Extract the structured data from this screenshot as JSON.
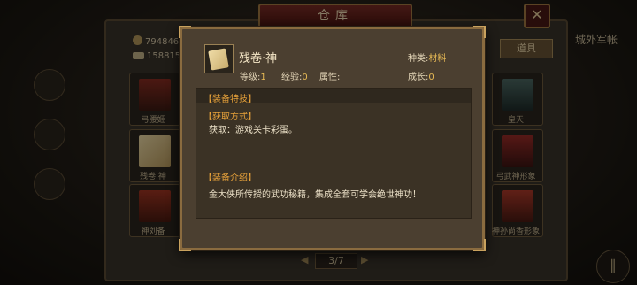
{
  "window": {
    "title": "仓库",
    "close_icon": "close-icon"
  },
  "resources": {
    "gold": "794846",
    "silver": "158815"
  },
  "side": {
    "tab_label": "道具",
    "right_label": "城外军帐"
  },
  "slots": [
    {
      "label": "弓腰姬",
      "icon": "character-portrait"
    },
    {
      "label": "残卷·神",
      "icon": "scroll-icon"
    },
    {
      "label": "神刘备",
      "icon": "character-portrait"
    },
    {
      "label": "皇天",
      "icon": "character-portrait"
    },
    {
      "label": "弓武神形象",
      "icon": "character-portrait"
    },
    {
      "label": "神孙尚香形象",
      "icon": "character-portrait"
    }
  ],
  "pager": {
    "text": "3/7"
  },
  "modal": {
    "item_name": "残卷·神",
    "type_label": "种类:",
    "type_value": "材料",
    "level_label": "等级:",
    "level_value": "1",
    "exp_label": "经验:",
    "exp_value": "0",
    "attr_label": "属性:",
    "growth_label": "成长:",
    "growth_value": "0",
    "section_special": "【装备特技】",
    "section_source": "【获取方式】",
    "source_text": "获取：游戏关卡彩蛋。",
    "section_intro": "【装备介绍】",
    "intro_text": "金大侠所传授的武功秘籍，集成全套可学会绝世神功！"
  }
}
